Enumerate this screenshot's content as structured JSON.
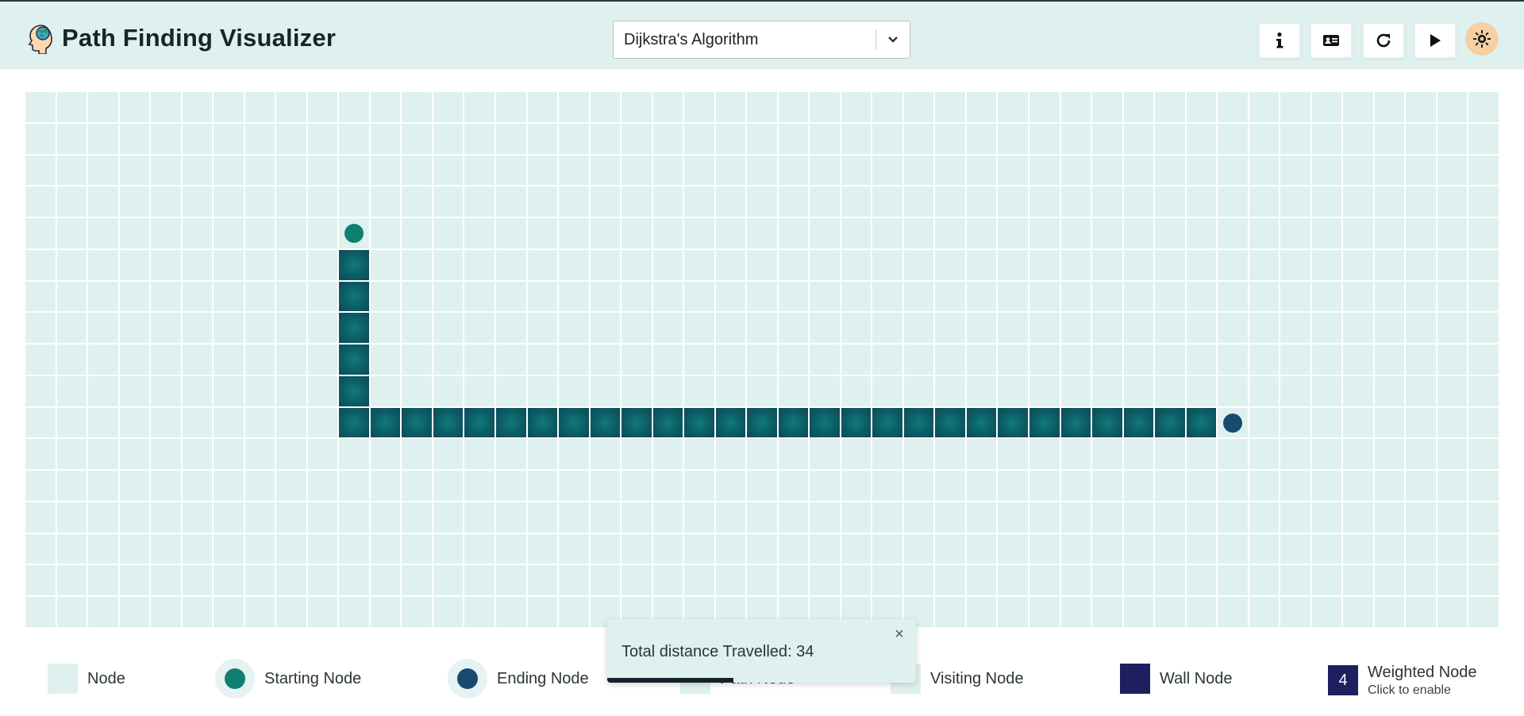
{
  "app": {
    "title": "Path Finding Visualizer"
  },
  "algorithm": {
    "selected": "Dijkstra's Algorithm"
  },
  "toolbar": [
    {
      "name": "info-button",
      "icon": "info-icon"
    },
    {
      "name": "id-card-button",
      "icon": "id-card-icon"
    },
    {
      "name": "reset-button",
      "icon": "refresh-icon"
    },
    {
      "name": "play-button",
      "icon": "play-icon"
    }
  ],
  "theme_toggle": {
    "icon": "sun-icon"
  },
  "grid": {
    "cols": 47,
    "rows": 17,
    "start": {
      "row": 4,
      "col": 10
    },
    "end": {
      "row": 10,
      "col": 38
    },
    "path": [
      [
        5,
        10
      ],
      [
        6,
        10
      ],
      [
        7,
        10
      ],
      [
        8,
        10
      ],
      [
        9,
        10
      ],
      [
        10,
        10
      ],
      [
        10,
        11
      ],
      [
        10,
        12
      ],
      [
        10,
        13
      ],
      [
        10,
        14
      ],
      [
        10,
        15
      ],
      [
        10,
        16
      ],
      [
        10,
        17
      ],
      [
        10,
        18
      ],
      [
        10,
        19
      ],
      [
        10,
        20
      ],
      [
        10,
        21
      ],
      [
        10,
        22
      ],
      [
        10,
        23
      ],
      [
        10,
        24
      ],
      [
        10,
        25
      ],
      [
        10,
        26
      ],
      [
        10,
        27
      ],
      [
        10,
        28
      ],
      [
        10,
        29
      ],
      [
        10,
        30
      ],
      [
        10,
        31
      ],
      [
        10,
        32
      ],
      [
        10,
        33
      ],
      [
        10,
        34
      ],
      [
        10,
        35
      ],
      [
        10,
        36
      ],
      [
        10,
        37
      ]
    ]
  },
  "legend": {
    "node": "Node",
    "start": "Starting Node",
    "end": "Ending Node",
    "path": "Path Node",
    "visiting": "Visiting Node",
    "wall": "Wall Node",
    "weighted": "Weighted Node",
    "weighted_value": "4",
    "weighted_hint": "Click to enable"
  },
  "toast": {
    "message": "Total distance Travelled: 34",
    "close": "×",
    "progress": 0.41
  },
  "colors": {
    "node": "#dff1ef",
    "start": "#0f7f73",
    "end": "#174a6e",
    "path": "#0c5c66",
    "wall": "#1e1f5e",
    "theme": "#f6cfa3"
  }
}
